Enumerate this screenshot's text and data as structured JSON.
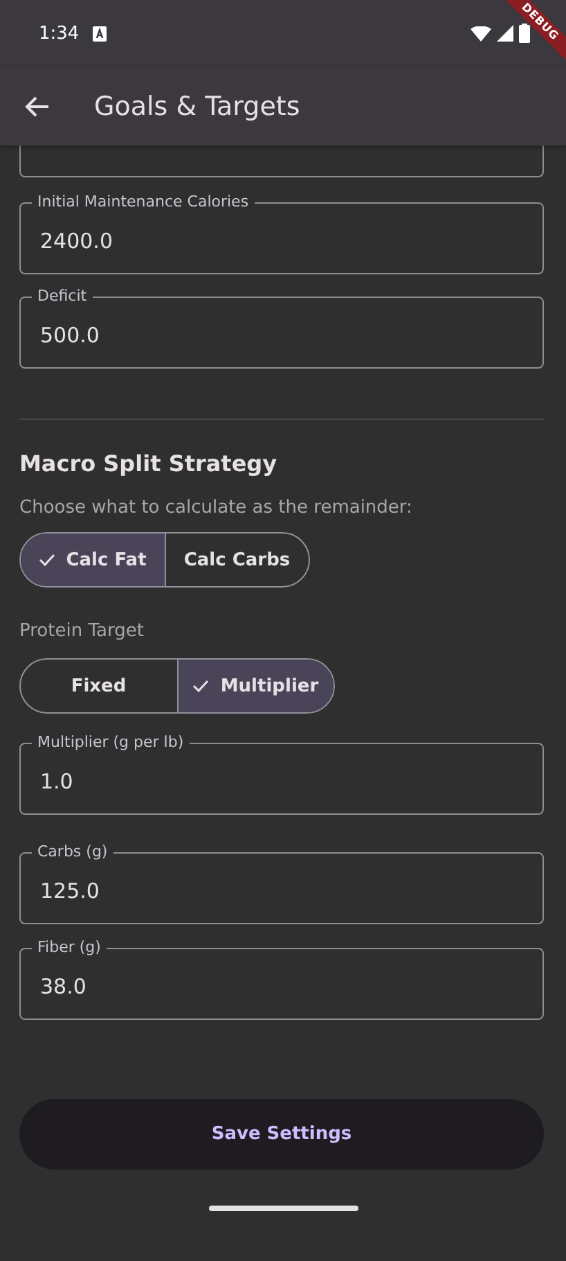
{
  "status_bar": {
    "time": "1:34",
    "debug_banner": "DEBUG"
  },
  "app_bar": {
    "title": "Goals & Targets"
  },
  "fields_top": [
    {
      "label": "Initial Maintenance Calories",
      "value": "2400.0"
    },
    {
      "label": "Deficit",
      "value": "500.0"
    }
  ],
  "macro_section": {
    "heading": "Macro Split Strategy",
    "subtitle": "Choose what to calculate as the remainder:",
    "remainder_options": [
      {
        "label": "Calc Fat",
        "selected": true
      },
      {
        "label": "Calc Carbs",
        "selected": false
      }
    ],
    "protein_label": "Protein Target",
    "protein_options": [
      {
        "label": "Fixed",
        "selected": false
      },
      {
        "label": "Multiplier",
        "selected": true
      }
    ]
  },
  "fields_bottom": [
    {
      "label": "Multiplier (g per lb)",
      "value": "1.0"
    },
    {
      "label": "Carbs (g)",
      "value": "125.0"
    },
    {
      "label": "Fiber (g)",
      "value": "38.0"
    }
  ],
  "save_button": "Save Settings"
}
